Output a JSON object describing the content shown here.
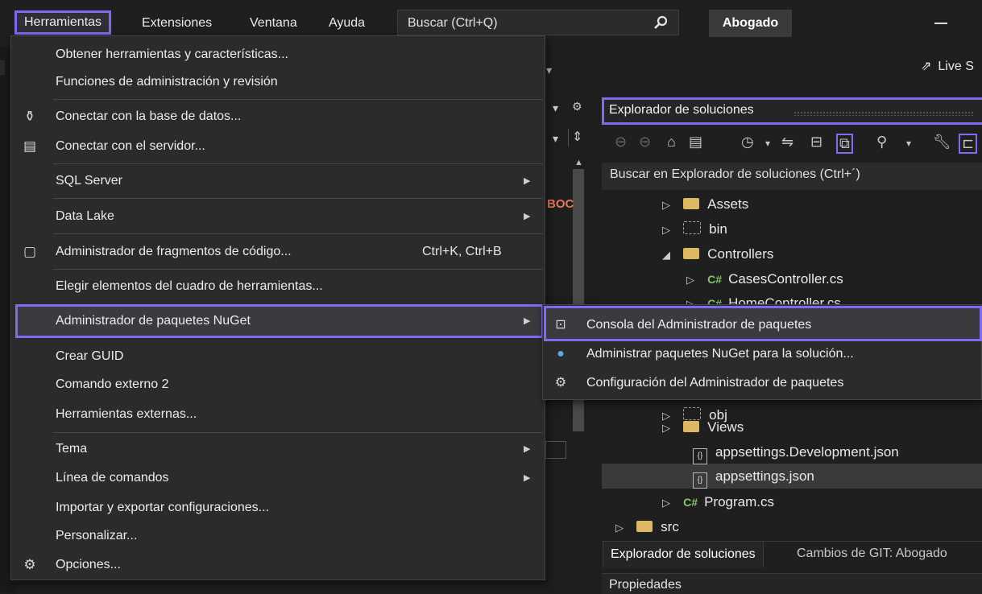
{
  "menubar": {
    "items": [
      "Herramientas",
      "Extensiones",
      "Ventana",
      "Ayuda"
    ],
    "search_placeholder": "Buscar (Ctrl+Q)",
    "profile": "Abogado"
  },
  "toolbar": {
    "live_share": "Live S"
  },
  "editor": {
    "fragment": "BOC"
  },
  "tools_menu": {
    "items": [
      {
        "label": "Obtener herramientas y características...",
        "icon": ""
      },
      {
        "label": "Funciones de administración y revisión",
        "icon": ""
      },
      {
        "label": "Conectar con la base de datos...",
        "icon": "database-connect-icon"
      },
      {
        "label": "Conectar con el servidor...",
        "icon": "server-connect-icon"
      },
      {
        "label": "SQL Server",
        "icon": "",
        "submenu": true
      },
      {
        "label": "Data Lake",
        "icon": "",
        "submenu": true
      },
      {
        "label": "Administrador de fragmentos de código...",
        "icon": "snippet-icon",
        "shortcut": "Ctrl+K, Ctrl+B"
      },
      {
        "label": "Elegir elementos del cuadro de herramientas...",
        "icon": ""
      },
      {
        "label": "Administrador de paquetes NuGet",
        "icon": "",
        "submenu": true,
        "highlighted": true
      },
      {
        "label": "Crear GUID",
        "icon": ""
      },
      {
        "label": "Comando externo 2",
        "icon": ""
      },
      {
        "label": "Herramientas externas...",
        "icon": ""
      },
      {
        "label": "Tema",
        "icon": "",
        "submenu": true
      },
      {
        "label": "Línea de comandos",
        "icon": "",
        "submenu": true
      },
      {
        "label": "Importar y exportar configuraciones...",
        "icon": ""
      },
      {
        "label": "Personalizar...",
        "icon": ""
      },
      {
        "label": "Opciones...",
        "icon": "gear-icon"
      }
    ]
  },
  "nuget_submenu": {
    "items": [
      {
        "label": "Consola del Administrador de paquetes",
        "icon": "console-icon",
        "highlighted": true
      },
      {
        "label": "Administrar paquetes NuGet para la solución...",
        "icon": "nuget-icon"
      },
      {
        "label": "Configuración del Administrador de paquetes",
        "icon": "gear-icon"
      }
    ]
  },
  "solution_explorer": {
    "title": "Explorador de soluciones",
    "search_placeholder": "Buscar en Explorador de soluciones (Ctrl+´)",
    "tree": [
      {
        "label": "Assets",
        "type": "folder"
      },
      {
        "label": "bin",
        "type": "folder-hidden"
      },
      {
        "label": "Controllers",
        "type": "folder",
        "expanded": true
      },
      {
        "label": "CasesController.cs",
        "type": "cs"
      },
      {
        "label": "HomeController.cs",
        "type": "cs"
      },
      {
        "label": "obj",
        "type": "folder-hidden"
      },
      {
        "label": "Views",
        "type": "folder"
      },
      {
        "label": "appsettings.Development.json",
        "type": "json"
      },
      {
        "label": "appsettings.json",
        "type": "json",
        "selected": true
      },
      {
        "label": "Program.cs",
        "type": "cs"
      },
      {
        "label": "src",
        "type": "folder"
      }
    ],
    "cs_badge": "C#",
    "json_badge": "{}",
    "tabs": [
      "Explorador de soluciones",
      "Cambios de GIT: Abogado"
    ],
    "properties_title": "Propiedades"
  },
  "colors": {
    "accent": "#7d6cf2",
    "menu_bg": "#2b2b2b",
    "folder": "#dcb862",
    "csharp": "#83c567"
  }
}
